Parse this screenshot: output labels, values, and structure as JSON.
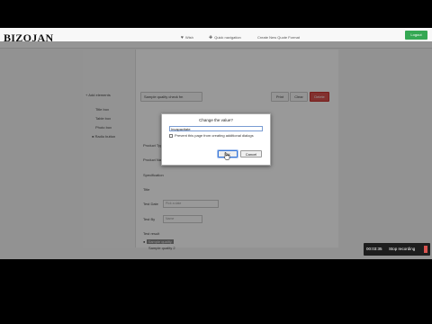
{
  "app": {
    "logo": "BIZOJAN"
  },
  "nav": {
    "items": [
      {
        "label": "Wish",
        "icon": "heart-icon"
      },
      {
        "label": "Quick navigation",
        "icon": "gift-icon"
      },
      {
        "label": "Create New Quote Format"
      }
    ],
    "action_label": "Logout"
  },
  "left_panel": {
    "add_label": "Add elements",
    "items": [
      "Title box",
      "Table box",
      "Photo box",
      "Radio button"
    ]
  },
  "toolbar": {
    "product_select": "Sample quality check fm",
    "btn_preview": "Print",
    "btn_clear": "Clear",
    "btn_delete": "Delete"
  },
  "form": {
    "labels": [
      "Product Type",
      "Product Name",
      "Specification",
      "Title",
      "Test Date",
      "Test By",
      "Test result"
    ],
    "placeholders": {
      "test_date": "Pick a date",
      "test_by": "Name"
    },
    "result_selected": "Sample quality",
    "result_note": "Sample quality 2"
  },
  "dialog": {
    "title": "Change the value?",
    "input_value": "Incapacitate",
    "checkbox_label": "Prevent this page from creating additional dialogs",
    "ok_label": "OK",
    "cancel_label": "Cancel"
  },
  "recorder": {
    "time": "00:03:35",
    "stop_label": "Stop recording"
  },
  "colors": {
    "primary": "#35a853",
    "danger": "#d9534f",
    "focus": "#3b78d8"
  }
}
